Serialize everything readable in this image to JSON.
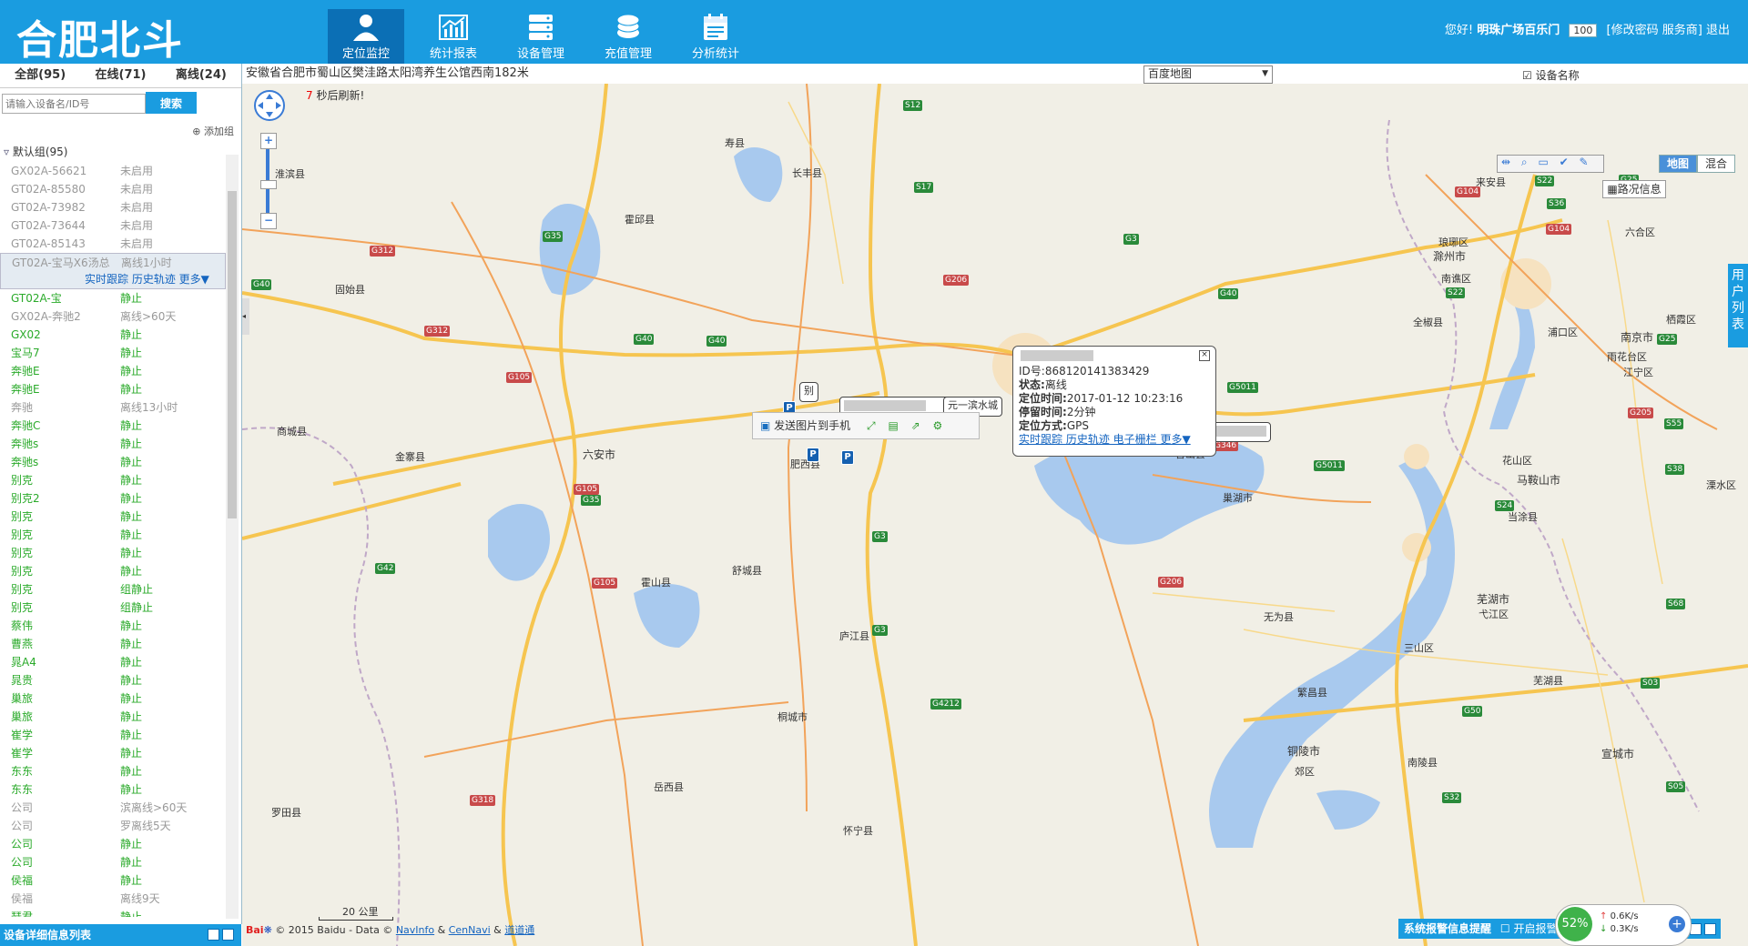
{
  "header": {
    "logo": "合肥北斗",
    "nav": [
      {
        "label": "定位监控",
        "icon": "person-icon",
        "active": true
      },
      {
        "label": "统计报表",
        "icon": "chart-icon",
        "active": false
      },
      {
        "label": "设备管理",
        "icon": "server-icon",
        "active": false
      },
      {
        "label": "充值管理",
        "icon": "coins-icon",
        "active": false
      },
      {
        "label": "分析统计",
        "icon": "calendar-icon",
        "active": false
      }
    ],
    "greeting": "您好!",
    "user_name": "明珠广场百乐门",
    "count_value": "100",
    "change_password": "[修改密码",
    "service_provider": "服务商]",
    "logout": "退出"
  },
  "left_panel": {
    "tabs": [
      {
        "label": "全部(95)"
      },
      {
        "label": "在线(71)"
      },
      {
        "label": "离线(24)"
      }
    ],
    "search_placeholder": "请输入设备名/ID号",
    "search_button": "搜索",
    "add_group": "添加组",
    "group_name": "默认组(95)",
    "devices": [
      {
        "name": "GX02A-56621",
        "status": "未启用",
        "tone": "gray"
      },
      {
        "name": "GT02A-85580",
        "status": "未启用",
        "tone": "gray"
      },
      {
        "name": "GT02A-73982",
        "status": "未启用",
        "tone": "gray"
      },
      {
        "name": "GT02A-73644",
        "status": "未启用",
        "tone": "gray"
      },
      {
        "name": "GT02A-85143",
        "status": "未启用",
        "tone": "gray"
      }
    ],
    "selected_device": {
      "name": "GT02A-宝马X6汤总",
      "status": "离线1小时",
      "actions": "实时跟踪 历史轨迹 更多▼"
    },
    "devices_after": [
      {
        "name": "GT02A-宝",
        "status": "静止",
        "tone": "green"
      },
      {
        "name": "GX02A-奔驰2",
        "status": "离线>60天",
        "tone": "gray"
      },
      {
        "name": "GX02",
        "status": "静止",
        "tone": "green"
      },
      {
        "name": "宝马7",
        "status": "静止",
        "tone": "green"
      },
      {
        "name": "奔驰E",
        "status": "静止",
        "tone": "green"
      },
      {
        "name": "奔驰E",
        "status": "静止",
        "tone": "green"
      },
      {
        "name": "奔驰",
        "status": "离线13小时",
        "tone": "gray"
      },
      {
        "name": "奔驰C",
        "status": "静止",
        "tone": "green"
      },
      {
        "name": "奔驰s",
        "status": "静止",
        "tone": "green"
      },
      {
        "name": "奔驰s",
        "status": "静止",
        "tone": "green"
      },
      {
        "name": "别克",
        "status": "静止",
        "tone": "green"
      },
      {
        "name": "别克2",
        "status": "静止",
        "tone": "green"
      },
      {
        "name": "别克",
        "status": "静止",
        "tone": "green"
      },
      {
        "name": "别克",
        "status": "静止",
        "tone": "green"
      },
      {
        "name": "别克",
        "status": "静止",
        "tone": "green"
      },
      {
        "name": "别克",
        "status": "静止",
        "tone": "green"
      },
      {
        "name": "别克",
        "status": "组静止",
        "tone": "green"
      },
      {
        "name": "别克",
        "status": "组静止",
        "tone": "green"
      },
      {
        "name": "蔡伟",
        "status": "静止",
        "tone": "green"
      },
      {
        "name": "曹燕",
        "status": "静止",
        "tone": "green"
      },
      {
        "name": "晁A4",
        "status": "静止",
        "tone": "green"
      },
      {
        "name": "晁贵",
        "status": "静止",
        "tone": "green"
      },
      {
        "name": "巢旅",
        "status": "静止",
        "tone": "green"
      },
      {
        "name": "巢旅",
        "status": "静止",
        "tone": "green"
      },
      {
        "name": "崔学",
        "status": "静止",
        "tone": "green"
      },
      {
        "name": "崔学",
        "status": "静止",
        "tone": "green"
      },
      {
        "name": "东东",
        "status": "静止",
        "tone": "green"
      },
      {
        "name": "东东",
        "status": "静止",
        "tone": "green"
      },
      {
        "name": "公司",
        "status": "滨离线>60天",
        "tone": "gray"
      },
      {
        "name": "公司",
        "status": "罗离线5天",
        "tone": "gray"
      },
      {
        "name": "公司",
        "status": "静止",
        "tone": "green"
      },
      {
        "name": "公司",
        "status": "静止",
        "tone": "green"
      },
      {
        "name": "侯福",
        "status": "静止",
        "tone": "green"
      },
      {
        "name": "侯福",
        "status": "离线9天",
        "tone": "gray"
      },
      {
        "name": "瑟君",
        "status": "静止",
        "tone": "green"
      }
    ],
    "detail_bar": "设备详细信息列表"
  },
  "map": {
    "address": "安徽省合肥市蜀山区樊洼路太阳湾养生公馆西南182米",
    "refresh_seconds": "7",
    "refresh_suffix": "秒后刷新!",
    "map_provider": "百度地图",
    "device_name_toggle": "设备名称",
    "map_type_map": "地图",
    "map_type_hybrid": "混合",
    "traffic": "路况信息",
    "user_list_tab": "用户列表",
    "popup": {
      "id_line": "ID号:868120141383429",
      "state_label": "状态:",
      "state_value": "离线",
      "time_label": "定位时间:",
      "time_value": "2017-01-12 10:23:16",
      "stay_label": "停留时间:",
      "stay_value": "2分钟",
      "method_label": "定位方式:",
      "method_value": "GPS",
      "links": "实时跟踪 历史轨迹 电子栅栏 更多▼",
      "close": "×"
    },
    "send_to_phone": "发送图片到手机",
    "label_binshui": "元一滨水城",
    "label_bie": "别",
    "scale": "20 公里",
    "copyright_prefix": "© 2015 Baidu - Data ©",
    "copyright_navinfo": "NavInfo",
    "copyright_amp": "&",
    "copyright_cennavi": "CenNavi",
    "copyright_daotong": "道道通",
    "alarm_text": "系统报警信息提醒",
    "alarm_sound": "开启报警声音",
    "net_percent": "52%",
    "net_up": "0.6K/s",
    "net_down": "0.3K/s",
    "cities": [
      {
        "name": "南京市"
      },
      {
        "name": "滁州市"
      },
      {
        "name": "六安市"
      },
      {
        "name": "马鞍山市"
      },
      {
        "name": "芜湖市"
      },
      {
        "name": "铜陵市"
      },
      {
        "name": "宣城市"
      },
      {
        "name": "巢湖市"
      },
      {
        "name": "肥西县"
      },
      {
        "name": "庐江县"
      },
      {
        "name": "舒城县"
      },
      {
        "name": "霍山县"
      },
      {
        "name": "霍邱县"
      },
      {
        "name": "寿县"
      },
      {
        "name": "长丰县"
      },
      {
        "name": "金寨县"
      },
      {
        "name": "固始县"
      },
      {
        "name": "商城县"
      },
      {
        "name": "含山县"
      },
      {
        "name": "无为县"
      },
      {
        "name": "繁昌县"
      },
      {
        "name": "南陵县"
      },
      {
        "name": "当涂县"
      },
      {
        "name": "全椒县"
      },
      {
        "name": "来安县"
      },
      {
        "name": "南谯区"
      },
      {
        "name": "琅琊区"
      },
      {
        "name": "浦口区"
      },
      {
        "name": "六合区"
      },
      {
        "name": "雨花台区"
      },
      {
        "name": "江宁区"
      },
      {
        "name": "栖霞区"
      },
      {
        "name": "岳西县"
      },
      {
        "name": "桐城市"
      },
      {
        "name": "怀宁县"
      },
      {
        "name": "罗田县"
      },
      {
        "name": "淮滨县"
      },
      {
        "name": "三山区"
      },
      {
        "name": "弋江区"
      },
      {
        "name": "芜湖县"
      },
      {
        "name": "郊区"
      },
      {
        "name": "花山区"
      },
      {
        "name": "溧水区"
      }
    ],
    "roads": [
      {
        "name": "G40"
      },
      {
        "name": "G312"
      },
      {
        "name": "G105"
      },
      {
        "name": "G35"
      },
      {
        "name": "G42"
      },
      {
        "name": "G3"
      },
      {
        "name": "G206"
      },
      {
        "name": "S17"
      },
      {
        "name": "S12"
      },
      {
        "name": "G5011"
      },
      {
        "name": "G346"
      },
      {
        "name": "G318"
      },
      {
        "name": "G4212"
      },
      {
        "name": "G50"
      },
      {
        "name": "S22"
      },
      {
        "name": "S24"
      },
      {
        "name": "S32"
      },
      {
        "name": "G25"
      },
      {
        "name": "S36"
      },
      {
        "name": "G104"
      },
      {
        "name": "G205"
      },
      {
        "name": "S55"
      },
      {
        "name": "S38"
      },
      {
        "name": "S68"
      },
      {
        "name": "S03"
      },
      {
        "name": "S05"
      }
    ]
  }
}
